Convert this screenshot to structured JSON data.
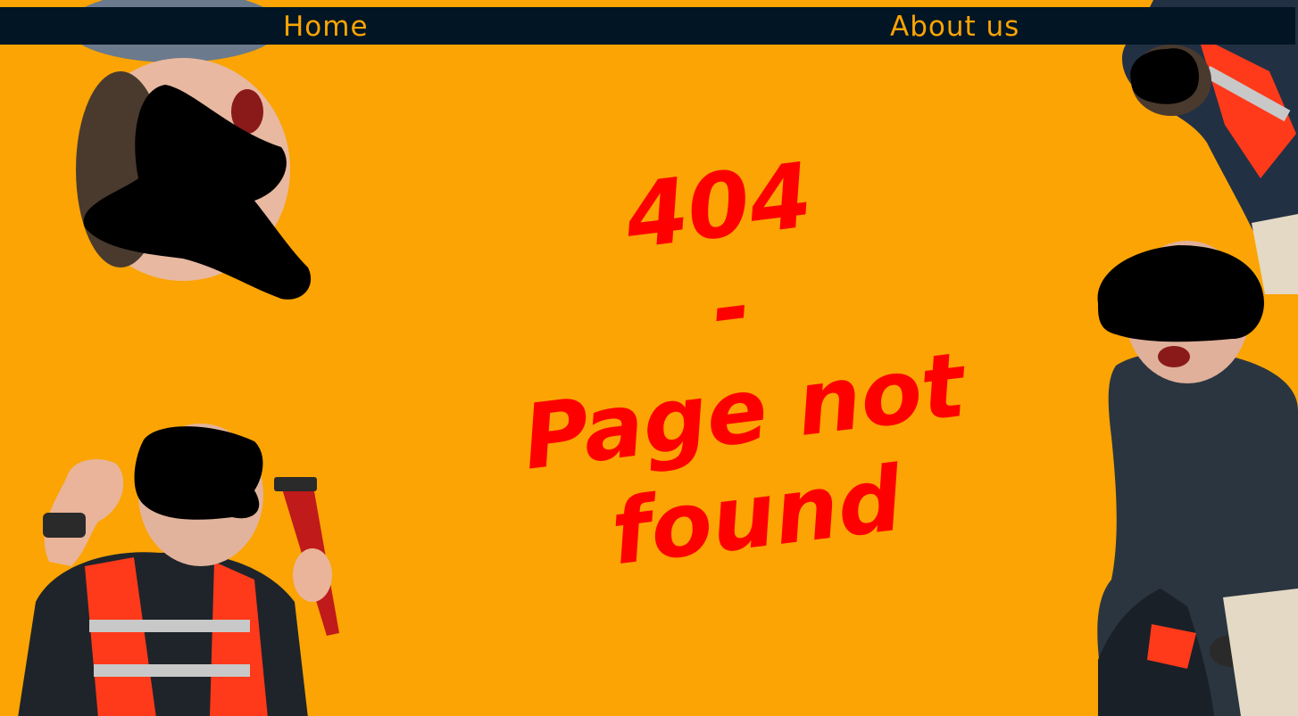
{
  "nav": {
    "home_label": "Home",
    "about_label": "About us"
  },
  "error": {
    "code": "404",
    "separator": "-",
    "line1": "Page not",
    "line2": "found"
  },
  "colors": {
    "background": "#FBA403",
    "nav_background": "#021524",
    "nav_text": "#FBA403",
    "error_text": "#FF0000"
  }
}
